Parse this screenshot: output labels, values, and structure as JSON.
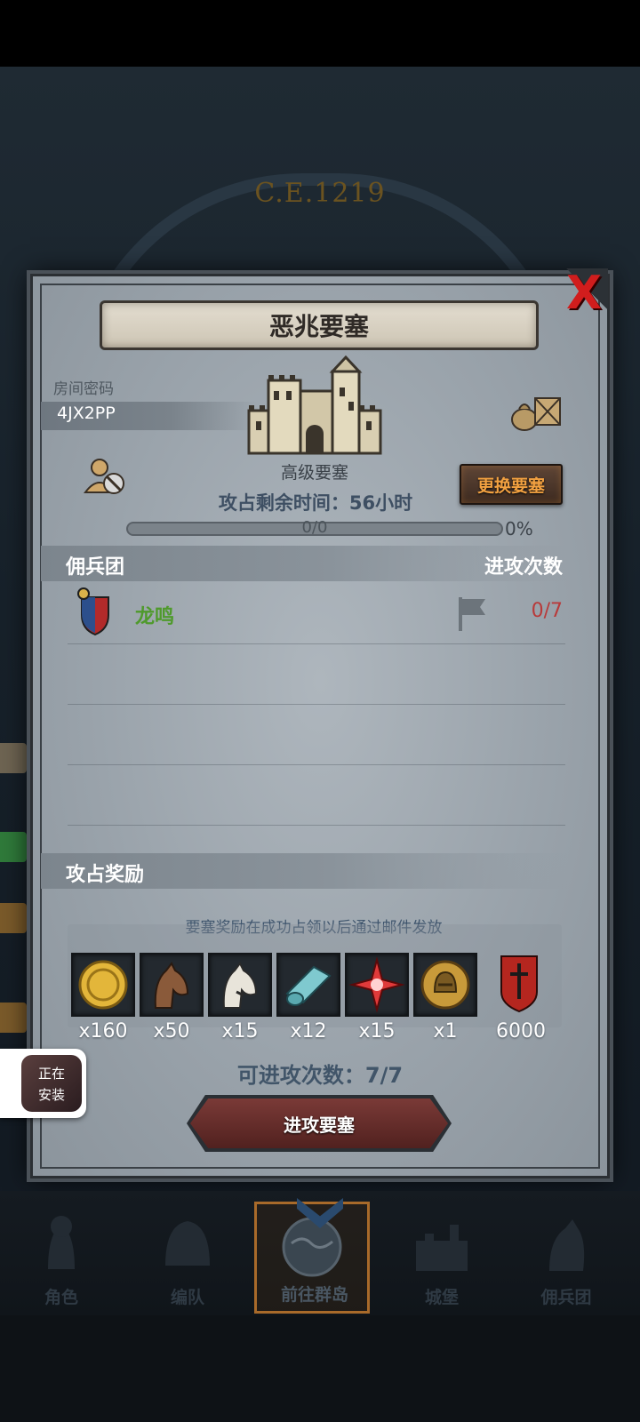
{
  "background": {
    "era_text": "C.E.1219"
  },
  "modal": {
    "title": "恶兆要塞",
    "close_label": "X",
    "room": {
      "label": "房间密码",
      "code": "4JX2PP"
    },
    "fortress": {
      "level": "高级要塞",
      "change_button": "更换要塞",
      "time_left": "攻占剩余时间：56小时",
      "progress_text": "0/0",
      "progress_percent": "0%",
      "progress_value": 0
    },
    "mercenary": {
      "header_left": "佣兵团",
      "header_right": "进攻次数",
      "rows": [
        {
          "name": "龙鸣",
          "count": "0/7"
        }
      ]
    },
    "rewards": {
      "title": "攻占奖励",
      "note": "要塞奖励在成功占领以后通过邮件发放",
      "items": [
        {
          "icon": "gold-coin-icon",
          "qty": "x160"
        },
        {
          "icon": "brown-horse-icon",
          "qty": "x50"
        },
        {
          "icon": "white-horse-icon",
          "qty": "x15"
        },
        {
          "icon": "cloth-roll-icon",
          "qty": "x12"
        },
        {
          "icon": "red-star-icon",
          "qty": "x15"
        },
        {
          "icon": "knight-helmet-medal-icon",
          "qty": "x1"
        },
        {
          "icon": "guild-banner-icon",
          "qty": "6000"
        }
      ]
    },
    "attempts": "可进攻次数：7/7",
    "attack_button": "进攻要塞"
  },
  "install_popup": {
    "line1": "正在",
    "line2": "安装"
  },
  "bottom_nav": {
    "items": [
      {
        "label": "角色",
        "active": false
      },
      {
        "label": "编队",
        "active": false
      },
      {
        "label": "前往群岛",
        "active": true
      },
      {
        "label": "城堡",
        "active": false
      },
      {
        "label": "佣兵团",
        "active": false
      }
    ]
  },
  "colors": {
    "accent_orange": "#f2a141",
    "merc_name_green": "#4f9a2c",
    "count_red": "#b83a3a",
    "close_red": "#d11d1d"
  }
}
